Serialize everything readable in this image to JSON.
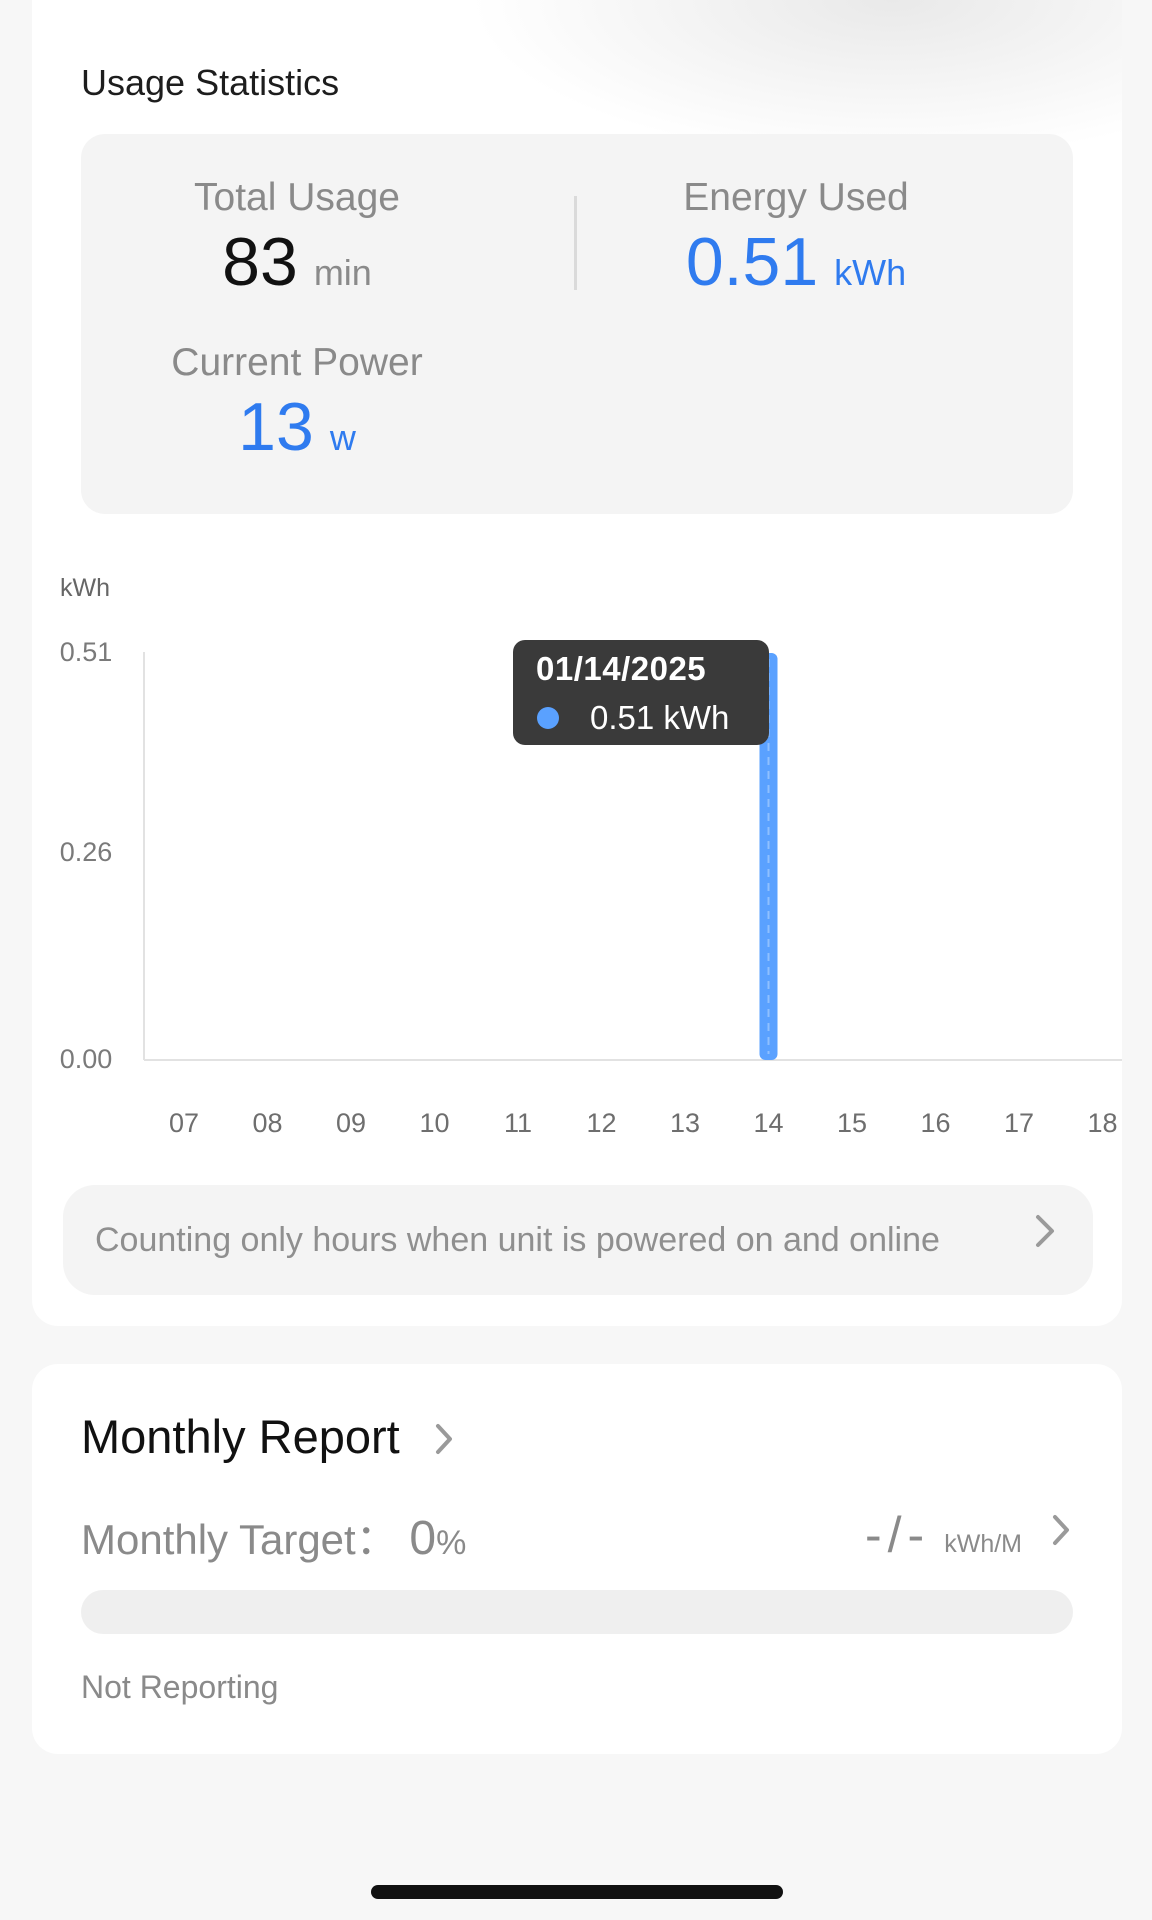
{
  "section": {
    "title": "Usage Statistics"
  },
  "stats": {
    "total_usage": {
      "label": "Total Usage",
      "value": "83",
      "unit": "min"
    },
    "energy_used": {
      "label": "Energy Used",
      "value": "0.51",
      "unit": "kWh"
    },
    "current_power": {
      "label": "Current Power",
      "value": "13",
      "unit": "w"
    }
  },
  "chart": {
    "y_title": "kWh",
    "tooltip": {
      "date": "01/14/2025",
      "value": "0.51 kWh"
    },
    "info_text": "Counting only hours when unit is powered on and online"
  },
  "chart_data": {
    "type": "bar",
    "categories": [
      "07",
      "08",
      "09",
      "10",
      "11",
      "12",
      "13",
      "14",
      "15",
      "16",
      "17",
      "18"
    ],
    "values": [
      0,
      0,
      0,
      0,
      0,
      0,
      0,
      0.51,
      0,
      0,
      0,
      0
    ],
    "y_ticks": [
      "0.00",
      "0.26",
      "0.51"
    ],
    "ylim": [
      0,
      0.51
    ],
    "ylabel": "kWh",
    "bar_color": "#5aa1ff",
    "grid": false
  },
  "monthly": {
    "title": "Monthly Report",
    "target_label": "Monthly Target：",
    "target_value": "0",
    "target_pct": "%",
    "target_amount": "-/-",
    "target_unit": "kWh/M",
    "progress_fraction": 0,
    "status": "Not Reporting"
  },
  "colors": {
    "accent": "#2f7bef",
    "bar": "#5aa1ff"
  }
}
